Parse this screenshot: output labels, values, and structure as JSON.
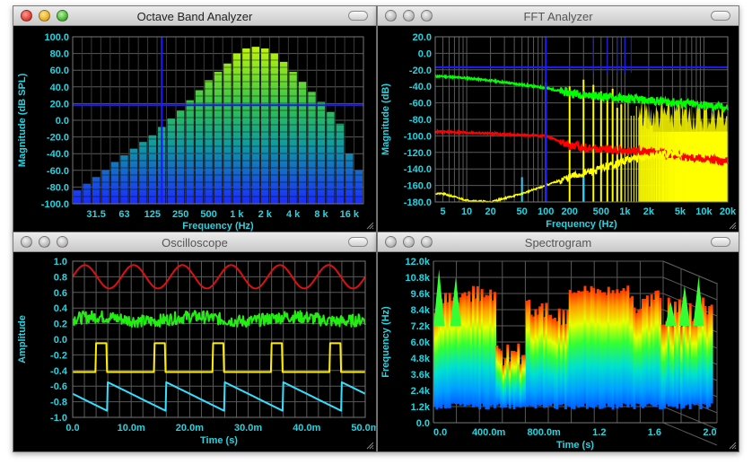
{
  "windows": {
    "octave": {
      "title": "Octave Band Analyzer",
      "active": true
    },
    "fft": {
      "title": "FFT Analyzer",
      "active": false
    },
    "scope": {
      "title": "Oscilloscope",
      "active": false
    },
    "spectro": {
      "title": "Spectrogram",
      "active": false
    }
  },
  "colors": {
    "axis_text": "#27d4e0",
    "grid": "#5a5a5a",
    "marker": "#1a1aff"
  },
  "chart_data": [
    {
      "type": "bar",
      "title": "Octave Band Analyzer",
      "xlabel": "Frequency (Hz)",
      "ylabel": "Magnitude (dB SPL)",
      "ylim": [
        -100,
        100
      ],
      "y_ticks": [
        "100.0",
        "80.0",
        "60.0",
        "40.0",
        "20.0",
        "0.0",
        "-20.0",
        "-40.0",
        "-60.0",
        "-80.0",
        "-100.0"
      ],
      "x_ticks": [
        "31.5",
        "63",
        "125",
        "250",
        "500",
        "1 k",
        "2 k",
        "4 k",
        "8 k",
        "16 k"
      ],
      "bands": [
        "20",
        "25",
        "31.5",
        "40",
        "50",
        "63",
        "80",
        "100",
        "125",
        "160",
        "200",
        "250",
        "315",
        "400",
        "500",
        "630",
        "800",
        "1 k",
        "1.25 k",
        "1.6 k",
        "2 k",
        "2.5 k",
        "3.15 k",
        "4 k",
        "5 k",
        "6.3 k",
        "8 k",
        "10 k",
        "12.5 k",
        "16 k",
        "20 k"
      ],
      "values": [
        -84,
        -76,
        -68,
        -60,
        -50,
        -42,
        -34,
        -26,
        -18,
        -8,
        2,
        12,
        24,
        36,
        48,
        58,
        68,
        80,
        86,
        88,
        86,
        80,
        70,
        58,
        46,
        34,
        22,
        10,
        -4,
        -40,
        -60
      ],
      "marker_x": "160",
      "marker_y": 18,
      "grid": true
    },
    {
      "type": "line",
      "title": "FFT Analyzer",
      "xlabel": "Frequency (Hz)",
      "ylabel": "Magnitude (dB)",
      "xscale": "log",
      "xlim": [
        4,
        20000
      ],
      "ylim": [
        -180,
        20
      ],
      "x_ticks": [
        "5",
        "10",
        "20",
        "50",
        "100",
        "200",
        "500",
        "1k",
        "2k",
        "5k",
        "10k",
        "20k"
      ],
      "y_ticks": [
        "20.0",
        "0.0",
        "-20.0",
        "-40.0",
        "-60.0",
        "-80.0",
        "-100.0",
        "-120.0",
        "-140.0",
        "-160.0",
        "-180.0"
      ],
      "series": [
        {
          "color": "#00ff00",
          "x": [
            5,
            10,
            20,
            50,
            100,
            200,
            500,
            1000,
            2000,
            5000,
            10000,
            20000
          ],
          "values": [
            -28,
            -30,
            -33,
            -38,
            -42,
            -48,
            -52,
            -55,
            -57,
            -60,
            -63,
            -66
          ]
        },
        {
          "color": "#ff0000",
          "x": [
            5,
            10,
            20,
            50,
            100,
            200,
            500,
            1000,
            2000,
            5000,
            10000,
            20000
          ],
          "values": [
            -95,
            -96,
            -97,
            -99,
            -100,
            -112,
            -116,
            -118,
            -120,
            -124,
            -128,
            -132
          ]
        },
        {
          "color": "#ffff00",
          "x": [
            5,
            10,
            20,
            50,
            100,
            200,
            500,
            1000,
            2000,
            5000,
            10000,
            20000
          ],
          "values": [
            -170,
            -178,
            -180,
            -170,
            -160,
            -150,
            -140,
            -130,
            -125,
            -120,
            -118,
            -115
          ]
        }
      ],
      "marker_x": 100,
      "marker_y": -17,
      "grid": true
    },
    {
      "type": "line",
      "title": "Oscilloscope",
      "xlabel": "Time (s)",
      "ylabel": "Amplitude",
      "xlim": [
        0,
        0.05
      ],
      "ylim": [
        -1.0,
        1.0
      ],
      "x_ticks": [
        "0.0",
        "10.0m",
        "20.0m",
        "30.0m",
        "40.0m",
        "50.0m"
      ],
      "y_ticks": [
        "1.0",
        "0.8",
        "0.6",
        "0.4",
        "0.2",
        "0.0",
        "-0.2",
        "-0.4",
        "-0.6",
        "-0.8",
        "-1.0"
      ],
      "series": [
        {
          "color": "#dd1111",
          "shape": "sine",
          "center": 0.8,
          "amplitude": 0.15,
          "frequency_hz": 120
        },
        {
          "color": "#22ee11",
          "shape": "noise",
          "center": 0.26,
          "amplitude": 0.08
        },
        {
          "color": "#ffee00",
          "shape": "square",
          "high": -0.05,
          "low": -0.42,
          "period_s": 0.01,
          "duty": 0.18
        },
        {
          "color": "#33e0ff",
          "shape": "sawtooth",
          "min": -0.92,
          "max": -0.55,
          "period_s": 0.01
        }
      ],
      "grid": true
    },
    {
      "type": "heatmap",
      "title": "Spectrogram",
      "xlabel": "Time (s)",
      "ylabel": "Frequency (Hz)",
      "xlim": [
        0,
        2.1
      ],
      "ylim": [
        0,
        12000
      ],
      "x_ticks": [
        "0.0",
        "400.0m",
        "800.0m",
        "1.2",
        "1.6",
        "2.0"
      ],
      "y_ticks": [
        "12.0k",
        "10.8k",
        "9.6k",
        "8.4k",
        "7.2k",
        "6.0k",
        "4.8k",
        "3.6k",
        "2.4k",
        "1.2k",
        "0.0"
      ],
      "grid": true
    }
  ]
}
